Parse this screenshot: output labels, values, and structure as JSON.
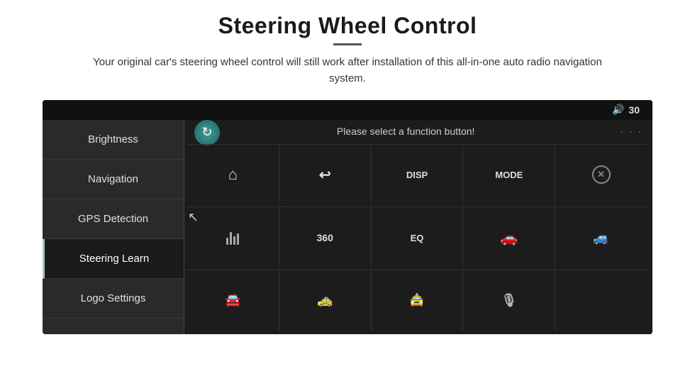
{
  "page": {
    "title": "Steering Wheel Control",
    "subtitle": "Your original car's steering wheel control will still work after installation of this all-in-one auto radio navigation system."
  },
  "topbar": {
    "volume_icon": "🔊",
    "volume_value": "30"
  },
  "sidebar": {
    "items": [
      {
        "id": "brightness",
        "label": "Brightness",
        "active": false
      },
      {
        "id": "navigation",
        "label": "Navigation",
        "active": false
      },
      {
        "id": "gps-detection",
        "label": "GPS Detection",
        "active": false
      },
      {
        "id": "steering-learn",
        "label": "Steering Learn",
        "active": true
      },
      {
        "id": "logo-settings",
        "label": "Logo Settings",
        "active": false
      }
    ]
  },
  "main": {
    "prompt": "Please select a function button!",
    "grid": {
      "row1": [
        "HOME",
        "BACK",
        "DISP",
        "MODE",
        "PHONE-OFF"
      ],
      "row2": [
        "EQ-BARS",
        "360",
        "EQ",
        "CAR1",
        "CAR2"
      ],
      "row3": [
        "CAR3",
        "CAR4",
        "CAR5",
        "MIC",
        ""
      ]
    }
  }
}
